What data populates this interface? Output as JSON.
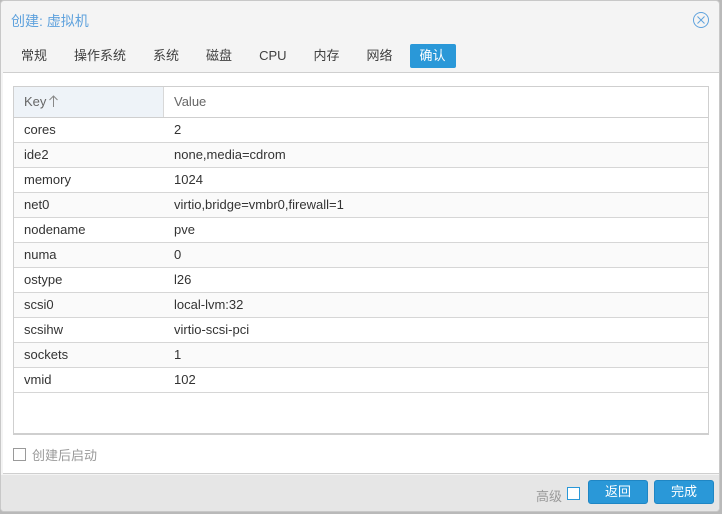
{
  "window": {
    "title": "创建: 虚拟机",
    "close_icon": "close-circle-icon"
  },
  "tabs": [
    {
      "label": "常规",
      "active": false
    },
    {
      "label": "操作系统",
      "active": false
    },
    {
      "label": "系统",
      "active": false
    },
    {
      "label": "磁盘",
      "active": false
    },
    {
      "label": "CPU",
      "active": false
    },
    {
      "label": "内存",
      "active": false
    },
    {
      "label": "网络",
      "active": false
    },
    {
      "label": "确认",
      "active": true
    }
  ],
  "grid": {
    "columns": {
      "key": "Key",
      "value": "Value",
      "sort": "ascending"
    },
    "rows": [
      {
        "key": "cores",
        "value": "2"
      },
      {
        "key": "ide2",
        "value": "none,media=cdrom"
      },
      {
        "key": "memory",
        "value": "1024"
      },
      {
        "key": "net0",
        "value": "virtio,bridge=vmbr0,firewall=1"
      },
      {
        "key": "nodename",
        "value": "pve"
      },
      {
        "key": "numa",
        "value": "0"
      },
      {
        "key": "ostype",
        "value": "l26"
      },
      {
        "key": "scsi0",
        "value": "local-lvm:32"
      },
      {
        "key": "scsihw",
        "value": "virtio-scsi-pci"
      },
      {
        "key": "sockets",
        "value": "1"
      },
      {
        "key": "vmid",
        "value": "102"
      }
    ]
  },
  "start_after_created": {
    "label": "创建后启动",
    "checked": false
  },
  "footer": {
    "advanced_label": "高级",
    "advanced_checked": false,
    "back_label": "返回",
    "finish_label": "完成"
  },
  "colors": {
    "accent": "#2a98d8",
    "title": "#5fa2dd"
  }
}
